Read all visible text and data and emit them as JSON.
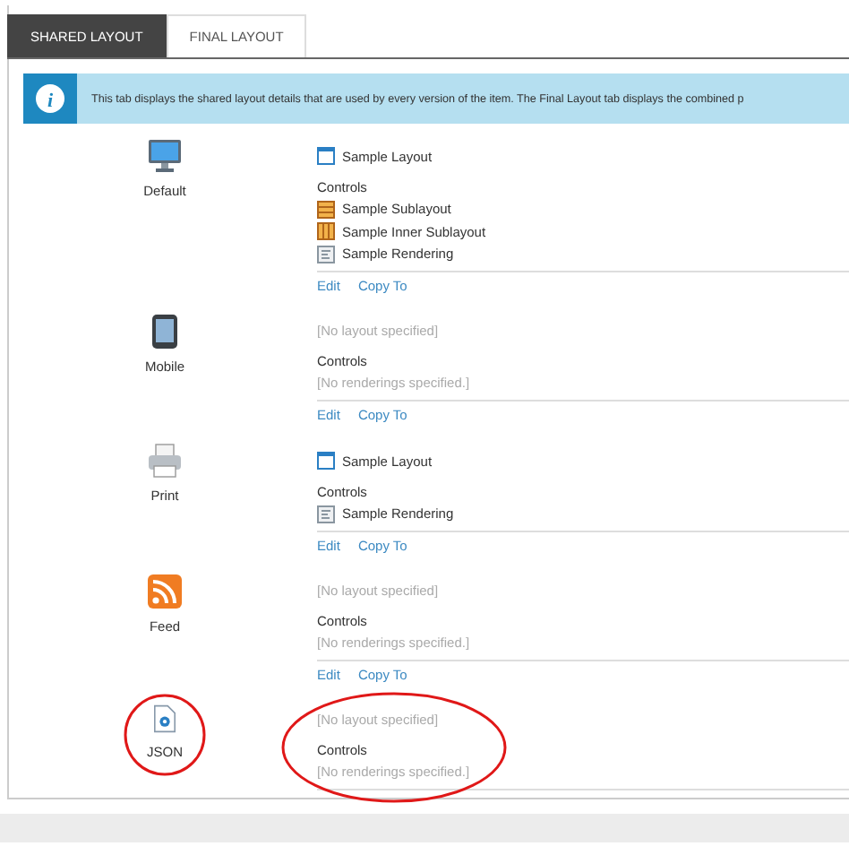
{
  "tabs": [
    {
      "label": "SHARED LAYOUT",
      "selected": true
    },
    {
      "label": "FINAL LAYOUT",
      "selected": false
    }
  ],
  "info": {
    "icon_glyph": "i",
    "text": "This tab displays the shared layout details that are used by every version of the item. The Final Layout tab displays the combined p"
  },
  "devices": [
    {
      "name": "Default",
      "kind": "desktop",
      "circled": false,
      "layout": "Sample Layout",
      "controls_label": "Controls",
      "renderings": [
        {
          "kind": "sublayout",
          "name": "Sample Sublayout"
        },
        {
          "kind": "inner-sublayout",
          "name": "Sample Inner Sublayout"
        },
        {
          "kind": "rendering",
          "name": "Sample Rendering"
        }
      ],
      "actions": [
        "Edit",
        "Copy To"
      ]
    },
    {
      "name": "Mobile",
      "kind": "mobile",
      "circled": false,
      "layout_placeholder": "[No layout specified]",
      "controls_label": "Controls",
      "renderings_placeholder": "[No renderings specified.]",
      "actions": [
        "Edit",
        "Copy To"
      ]
    },
    {
      "name": "Print",
      "kind": "printer",
      "circled": false,
      "layout": "Sample Layout",
      "controls_label": "Controls",
      "renderings": [
        {
          "kind": "rendering",
          "name": "Sample Rendering"
        }
      ],
      "actions": [
        "Edit",
        "Copy To"
      ]
    },
    {
      "name": "Feed",
      "kind": "feed",
      "circled": false,
      "layout_placeholder": "[No layout specified]",
      "controls_label": "Controls",
      "renderings_placeholder": "[No renderings specified.]",
      "actions": [
        "Edit",
        "Copy To"
      ]
    },
    {
      "name": "JSON",
      "kind": "json",
      "circled": true,
      "layout_placeholder": "[No layout specified]",
      "controls_label": "Controls",
      "renderings_placeholder": "[No renderings specified.]"
    }
  ]
}
